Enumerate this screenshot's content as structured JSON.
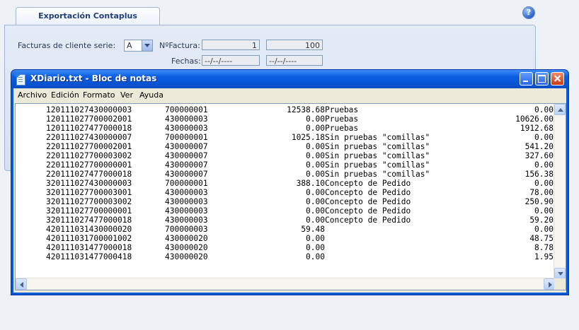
{
  "app": {
    "tab_title": "Exportación Contaplus",
    "help_icon": "help-icon",
    "series_label": "Facturas de cliente serie:",
    "series_value": "A",
    "nfactura_label": "NºFactura:",
    "nfactura_from": "1",
    "nfactura_to": "100",
    "fechas_label": "Fechas:",
    "fecha_from": "--/--/----",
    "fecha_to": "--/--/----"
  },
  "notepad": {
    "title": "XDiario.txt - Bloc de notas",
    "menu": [
      "Archivo",
      "Edición",
      "Formato",
      "Ver",
      "Ayuda"
    ],
    "rows": [
      {
        "a": "120111027430000003",
        "b": "700000001",
        "amt": "12538.68",
        "desc": "Pruebas",
        "right": "0.00"
      },
      {
        "a": "120111027700002001",
        "b": "430000003",
        "amt": "0.00",
        "desc": "Pruebas",
        "right": "10626.00"
      },
      {
        "a": "120111027477000018",
        "b": "430000003",
        "amt": "0.00",
        "desc": "Pruebas",
        "right": "1912.68"
      },
      {
        "a": "220111027430000007",
        "b": "700000001",
        "amt": "1025.18",
        "desc": "Sin pruebas \"comillas\"",
        "right": "0.00"
      },
      {
        "a": "220111027700002001",
        "b": "430000007",
        "amt": "0.00",
        "desc": "Sin pruebas \"comillas\"",
        "right": "541.20"
      },
      {
        "a": "220111027700003002",
        "b": "430000007",
        "amt": "0.00",
        "desc": "Sin pruebas \"comillas\"",
        "right": "327.60"
      },
      {
        "a": "220111027700000001",
        "b": "430000007",
        "amt": "0.00",
        "desc": "Sin pruebas \"comillas\"",
        "right": "0.00"
      },
      {
        "a": "220111027477000018",
        "b": "430000007",
        "amt": "0.00",
        "desc": "Sin pruebas \"comillas\"",
        "right": "156.38"
      },
      {
        "a": "320111027430000003",
        "b": "700000001",
        "amt": "388.10",
        "desc": "Concepto de Pedido",
        "right": "0.00"
      },
      {
        "a": "320111027700003001",
        "b": "430000003",
        "amt": "0.00",
        "desc": "Concepto de Pedido",
        "right": "78.00"
      },
      {
        "a": "320111027700003002",
        "b": "430000003",
        "amt": "0.00",
        "desc": "Concepto de Pedido",
        "right": "250.90"
      },
      {
        "a": "320111027700000001",
        "b": "430000003",
        "amt": "0.00",
        "desc": "Concepto de Pedido",
        "right": "0.00"
      },
      {
        "a": "320111027477000018",
        "b": "430000003",
        "amt": "0.00",
        "desc": "Concepto de Pedido",
        "right": "59.20"
      },
      {
        "a": "420111031430000020",
        "b": "700000003",
        "amt": "59.48",
        "desc": "",
        "right": "0.00"
      },
      {
        "a": "420111031700001002",
        "b": "430000020",
        "amt": "0.00",
        "desc": "",
        "right": "48.75"
      },
      {
        "a": "420111031477000018",
        "b": "430000020",
        "amt": "0.00",
        "desc": "",
        "right": "8.78"
      },
      {
        "a": "420111031477000418",
        "b": "430000020",
        "amt": "0.00",
        "desc": "",
        "right": "1.95"
      }
    ]
  }
}
